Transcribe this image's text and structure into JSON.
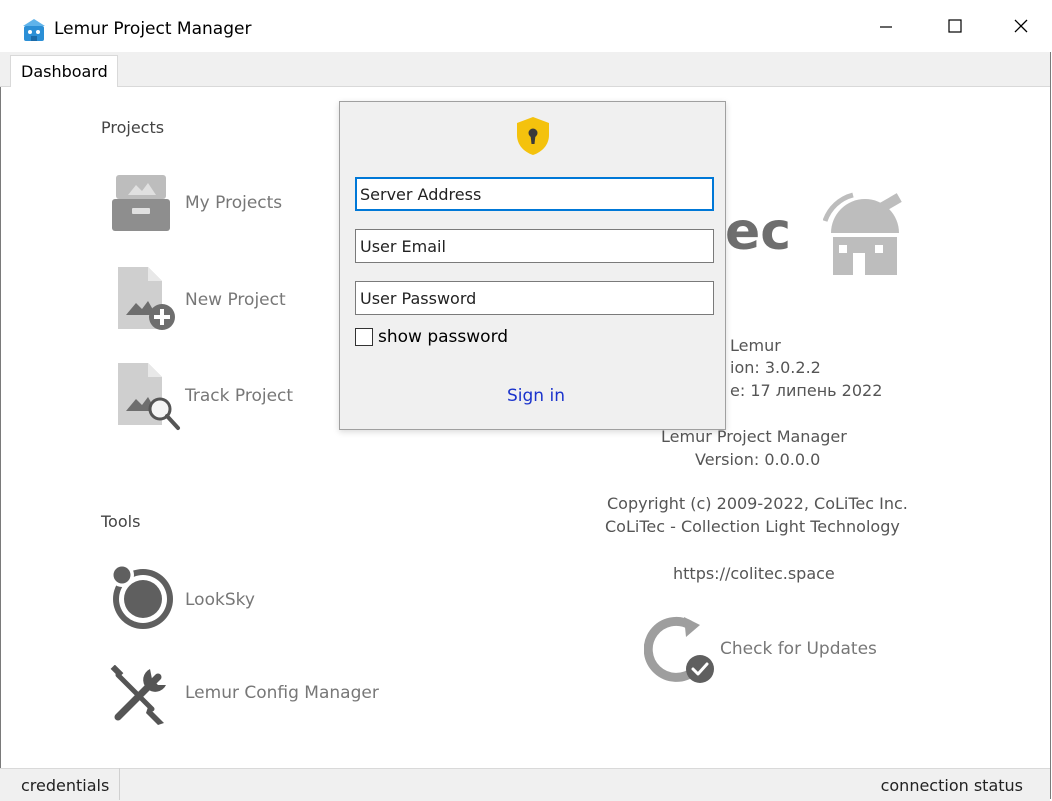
{
  "window": {
    "title": "Lemur Project Manager",
    "minimize_label": "minimize",
    "maximize_label": "maximize",
    "close_label": "close"
  },
  "tabs": [
    {
      "label": "Dashboard",
      "active": true
    }
  ],
  "projects": {
    "heading": "Projects",
    "items": [
      {
        "label": "My Projects",
        "icon": "archive-box-icon"
      },
      {
        "label": "New Project",
        "icon": "new-document-icon"
      },
      {
        "label": "Track Project",
        "icon": "search-document-icon"
      }
    ]
  },
  "tools": {
    "heading": "Tools",
    "items": [
      {
        "label": "LookSky",
        "icon": "looksky-icon"
      },
      {
        "label": "Lemur Config Manager",
        "icon": "tools-icon"
      }
    ]
  },
  "about": {
    "logo_partial": "ec",
    "lemur_name": "Lemur",
    "lemur_version_partial": "ion: 3.0.2.2",
    "lemur_date_partial": "e: 17 липень 2022",
    "app_name": "Lemur Project Manager",
    "app_version": "Version: 0.0.0.0",
    "copyright": "Copyright (c) 2009-2022, CoLiTec Inc.",
    "company": "CoLiTec - Collection Light Technology",
    "url": "https://colitec.space",
    "check_updates": "Check for Updates"
  },
  "login": {
    "server_placeholder": "Server Address",
    "email_placeholder": "User Email",
    "password_placeholder": "User Password",
    "show_password_label": "show password",
    "show_password_checked": false,
    "sign_in_label": "Sign in",
    "icon": "shield-lock-icon"
  },
  "status": {
    "left": "credentials",
    "right": "connection status"
  },
  "colors": {
    "accent": "#0078d7",
    "link": "#1a33cc",
    "shield": "#f4c20d",
    "icon_gray": "#9e9e9e"
  }
}
